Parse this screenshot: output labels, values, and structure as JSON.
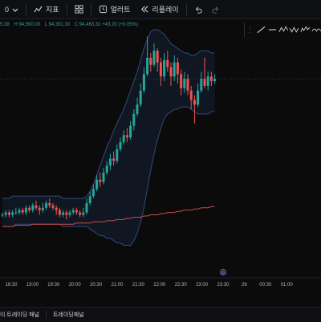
{
  "toolbar": {
    "interval_partial": "0",
    "indicators_label": "지표",
    "alert_label": "얼러트",
    "replay_label": "리플레이"
  },
  "legend": {
    "items": [
      {
        "text": "5.38",
        "color": "#26a69a"
      },
      {
        "text": "H 94,590.00",
        "color": "#26a69a"
      },
      {
        "text": "L 94,391.30",
        "color": "#26a69a"
      },
      {
        "text": "C 94,463.31 +43.20 (+0.05%)",
        "color": "#26a69a"
      }
    ]
  },
  "drawing_tools": [
    "trend-line",
    "horizontal-line",
    "pattern-abcd",
    "pattern-xabcd",
    "elliott-wave",
    "cycle-pattern"
  ],
  "bottom_tabs": [
    "이 트레이딩 패널",
    "트레이딩패널"
  ],
  "chart_data": {
    "type": "candlestick",
    "time_labels": [
      "18:30",
      "19:00",
      "19:30",
      "20:00",
      "20:30",
      "21:00",
      "21:30",
      "22:00",
      "22:30",
      "23:00",
      "23:30",
      "26",
      "00:30",
      "01:00"
    ],
    "event_marker": "D",
    "colors": {
      "up": "#26a69a",
      "down": "#ef5350",
      "band": "#2e4b7a",
      "ma": "#c94a4a"
    },
    "candles": [
      [
        0.19,
        0.19,
        0.2,
        0.18
      ],
      [
        0.19,
        0.2,
        0.21,
        0.18
      ],
      [
        0.2,
        0.19,
        0.21,
        0.18
      ],
      [
        0.19,
        0.2,
        0.21,
        0.18
      ],
      [
        0.2,
        0.2,
        0.22,
        0.19
      ],
      [
        0.2,
        0.21,
        0.22,
        0.19
      ],
      [
        0.21,
        0.2,
        0.22,
        0.19
      ],
      [
        0.2,
        0.22,
        0.23,
        0.19
      ],
      [
        0.22,
        0.21,
        0.23,
        0.2
      ],
      [
        0.21,
        0.23,
        0.24,
        0.2
      ],
      [
        0.23,
        0.22,
        0.25,
        0.21
      ],
      [
        0.22,
        0.21,
        0.23,
        0.19
      ],
      [
        0.21,
        0.22,
        0.24,
        0.2
      ],
      [
        0.22,
        0.24,
        0.25,
        0.21
      ],
      [
        0.24,
        0.23,
        0.26,
        0.22
      ],
      [
        0.23,
        0.22,
        0.24,
        0.21
      ],
      [
        0.22,
        0.21,
        0.23,
        0.19
      ],
      [
        0.21,
        0.19,
        0.22,
        0.18
      ],
      [
        0.19,
        0.2,
        0.21,
        0.18
      ],
      [
        0.2,
        0.19,
        0.21,
        0.17
      ],
      [
        0.19,
        0.2,
        0.21,
        0.18
      ],
      [
        0.2,
        0.21,
        0.22,
        0.19
      ],
      [
        0.21,
        0.2,
        0.22,
        0.19
      ],
      [
        0.2,
        0.19,
        0.21,
        0.18
      ],
      [
        0.19,
        0.2,
        0.22,
        0.18
      ],
      [
        0.2,
        0.24,
        0.26,
        0.19
      ],
      [
        0.24,
        0.27,
        0.29,
        0.23
      ],
      [
        0.27,
        0.3,
        0.32,
        0.26
      ],
      [
        0.3,
        0.34,
        0.36,
        0.29
      ],
      [
        0.34,
        0.33,
        0.37,
        0.31
      ],
      [
        0.33,
        0.37,
        0.39,
        0.32
      ],
      [
        0.37,
        0.4,
        0.42,
        0.36
      ],
      [
        0.4,
        0.43,
        0.45,
        0.38
      ],
      [
        0.43,
        0.42,
        0.46,
        0.4
      ],
      [
        0.42,
        0.47,
        0.49,
        0.41
      ],
      [
        0.47,
        0.5,
        0.52,
        0.46
      ],
      [
        0.5,
        0.53,
        0.55,
        0.49
      ],
      [
        0.53,
        0.52,
        0.56,
        0.5
      ],
      [
        0.52,
        0.57,
        0.59,
        0.51
      ],
      [
        0.57,
        0.62,
        0.64,
        0.55
      ],
      [
        0.62,
        0.66,
        0.69,
        0.61
      ],
      [
        0.66,
        0.72,
        0.75,
        0.65
      ],
      [
        0.72,
        0.79,
        0.82,
        0.71
      ],
      [
        0.79,
        0.86,
        0.95,
        0.78
      ],
      [
        0.86,
        0.83,
        0.88,
        0.8
      ],
      [
        0.83,
        0.89,
        0.92,
        0.82
      ],
      [
        0.89,
        0.84,
        0.9,
        0.8
      ],
      [
        0.84,
        0.78,
        0.86,
        0.74
      ],
      [
        0.78,
        0.85,
        0.88,
        0.76
      ],
      [
        0.85,
        0.82,
        0.89,
        0.8
      ],
      [
        0.82,
        0.78,
        0.84,
        0.74
      ],
      [
        0.78,
        0.84,
        0.87,
        0.76
      ],
      [
        0.84,
        0.79,
        0.86,
        0.75
      ],
      [
        0.79,
        0.73,
        0.81,
        0.7
      ],
      [
        0.73,
        0.77,
        0.8,
        0.71
      ],
      [
        0.77,
        0.72,
        0.79,
        0.7
      ],
      [
        0.72,
        0.68,
        0.74,
        0.64
      ],
      [
        0.68,
        0.66,
        0.7,
        0.58
      ],
      [
        0.66,
        0.72,
        0.75,
        0.65
      ],
      [
        0.72,
        0.77,
        0.8,
        0.71
      ],
      [
        0.77,
        0.74,
        0.86,
        0.73
      ],
      [
        0.74,
        0.78,
        0.8,
        0.72
      ],
      [
        0.78,
        0.76,
        0.8,
        0.74
      ],
      [
        0.76,
        0.77,
        0.79,
        0.75
      ]
    ],
    "band_upper": [
      0.26,
      0.26,
      0.26,
      0.27,
      0.27,
      0.27,
      0.27,
      0.27,
      0.27,
      0.27,
      0.27,
      0.27,
      0.27,
      0.27,
      0.27,
      0.27,
      0.27,
      0.27,
      0.26,
      0.26,
      0.26,
      0.26,
      0.26,
      0.26,
      0.26,
      0.27,
      0.29,
      0.32,
      0.36,
      0.4,
      0.44,
      0.48,
      0.51,
      0.55,
      0.58,
      0.61,
      0.64,
      0.68,
      0.72,
      0.76,
      0.8,
      0.85,
      0.9,
      0.94,
      0.97,
      0.98,
      0.98,
      0.97,
      0.96,
      0.94,
      0.92,
      0.91,
      0.9,
      0.89,
      0.88,
      0.88,
      0.87,
      0.87,
      0.88,
      0.89,
      0.89,
      0.89,
      0.88,
      0.88
    ],
    "band_lower": [
      0.14,
      0.14,
      0.14,
      0.14,
      0.15,
      0.15,
      0.15,
      0.15,
      0.15,
      0.15,
      0.15,
      0.15,
      0.15,
      0.15,
      0.15,
      0.15,
      0.15,
      0.15,
      0.14,
      0.14,
      0.14,
      0.14,
      0.14,
      0.14,
      0.14,
      0.14,
      0.13,
      0.12,
      0.11,
      0.1,
      0.1,
      0.09,
      0.09,
      0.08,
      0.07,
      0.07,
      0.06,
      0.06,
      0.06,
      0.08,
      0.11,
      0.16,
      0.22,
      0.3,
      0.38,
      0.45,
      0.51,
      0.56,
      0.6,
      0.62,
      0.63,
      0.64,
      0.64,
      0.65,
      0.65,
      0.65,
      0.64,
      0.63,
      0.62,
      0.62,
      0.62,
      0.62,
      0.63,
      0.63
    ],
    "ma": [
      0.14,
      0.14,
      0.14,
      0.14,
      0.145,
      0.145,
      0.145,
      0.145,
      0.145,
      0.15,
      0.15,
      0.15,
      0.15,
      0.15,
      0.15,
      0.15,
      0.15,
      0.15,
      0.15,
      0.15,
      0.15,
      0.15,
      0.155,
      0.155,
      0.155,
      0.155,
      0.155,
      0.16,
      0.16,
      0.16,
      0.16,
      0.165,
      0.165,
      0.165,
      0.17,
      0.17,
      0.17,
      0.175,
      0.175,
      0.18,
      0.18,
      0.18,
      0.185,
      0.185,
      0.19,
      0.19,
      0.19,
      0.195,
      0.195,
      0.2,
      0.2,
      0.2,
      0.205,
      0.205,
      0.21,
      0.21,
      0.21,
      0.215,
      0.215,
      0.22,
      0.22,
      0.22,
      0.225,
      0.225
    ]
  }
}
